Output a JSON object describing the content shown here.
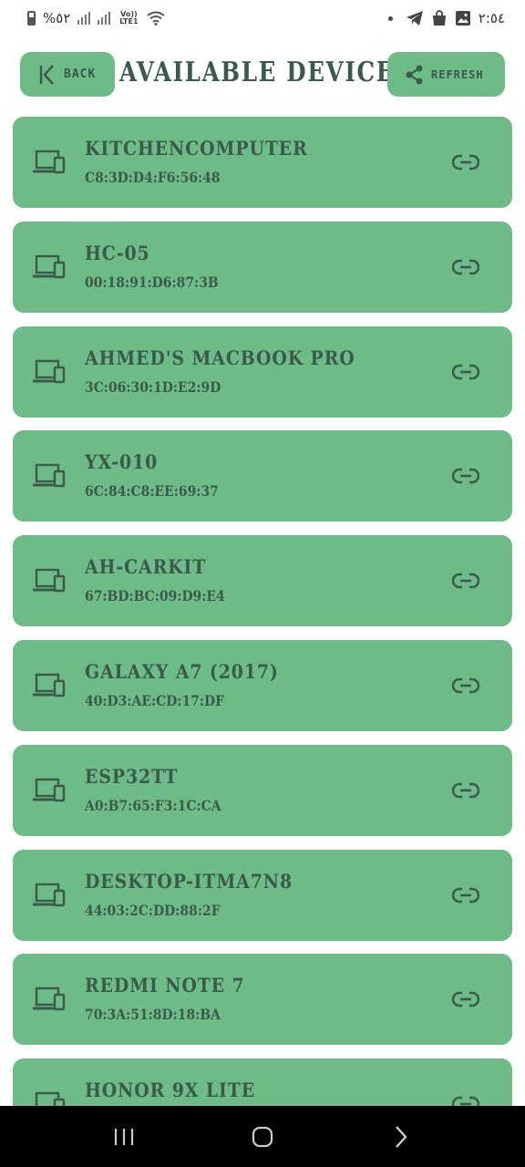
{
  "status_bar": {
    "battery_text": "%٥٢",
    "lte_text": "Vo)) LTE1",
    "time": "٢:٥٤"
  },
  "header": {
    "back_label": "Back",
    "title": "Available Devices",
    "refresh_label": "Refresh"
  },
  "devices": [
    {
      "name": "KitchenComputer",
      "mac": "C8:3D:D4:F6:56:48"
    },
    {
      "name": "HC-05",
      "mac": "00:18:91:D6:87:3B"
    },
    {
      "name": "Ahmed's MacBook Pro",
      "mac": "3C:06:30:1D:E2:9D"
    },
    {
      "name": "YX-010",
      "mac": "6C:84:C8:EE:69:37"
    },
    {
      "name": "AH-CARKIT",
      "mac": "67:BD:BC:09:D9:E4"
    },
    {
      "name": "Galaxy A7 (2017)",
      "mac": "40:D3:AE:CD:17:DF"
    },
    {
      "name": "ESP32TT",
      "mac": "A0:B7:65:F3:1C:CA"
    },
    {
      "name": "DESKTOP-ITMA7N8",
      "mac": "44:03:2C:DD:88:2F"
    },
    {
      "name": "Redmi Note 7",
      "mac": "70:3A:51:8D:18:BA"
    },
    {
      "name": "HONOR 9X Lite",
      "mac": ""
    }
  ],
  "colors": {
    "card": "#6dbb86",
    "text": "#3b5a4a"
  }
}
